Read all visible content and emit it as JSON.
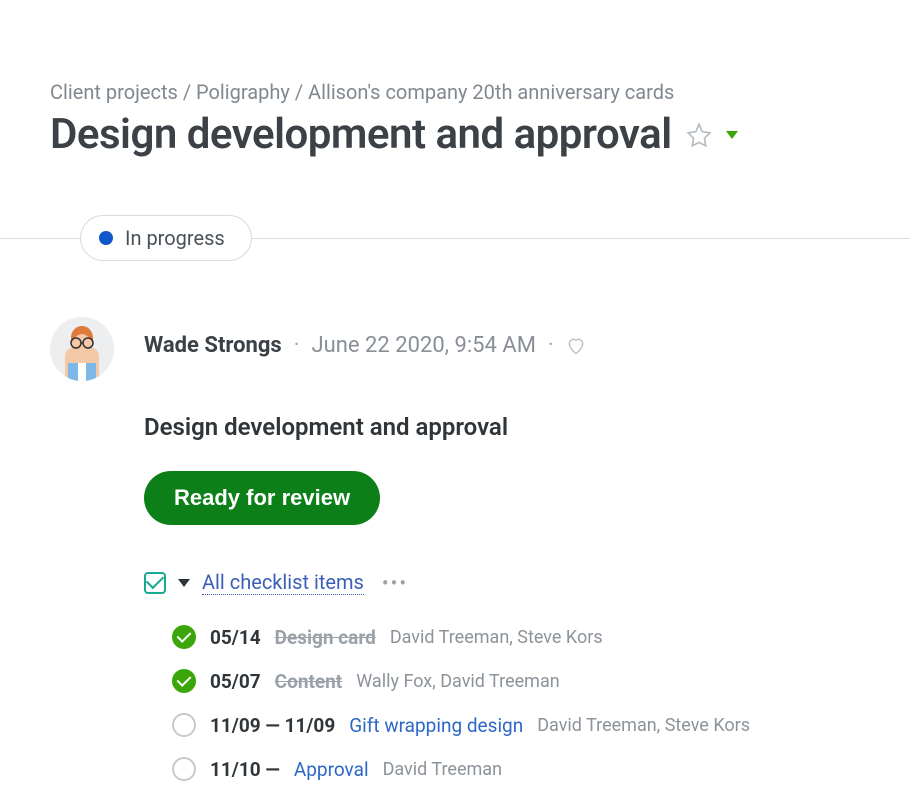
{
  "breadcrumb": {
    "level1": "Client projects",
    "level2": "Poligraphy",
    "level3": "Allison's company 20th anniversary cards"
  },
  "page_title": "Design development and approval",
  "status": {
    "label": "In progress",
    "color": "#1257c9"
  },
  "post": {
    "author": "Wade Strongs",
    "timestamp": "June 22 2020, 9:54 AM",
    "title": "Design development and approval",
    "action_label": "Ready for review"
  },
  "checklist": {
    "header_link": "All checklist items",
    "items": [
      {
        "done": true,
        "date": "05/14",
        "title": "Design card",
        "assignees": "David Treeman, Steve Kors"
      },
      {
        "done": true,
        "date": "05/07",
        "title": "Content",
        "assignees": "Wally Fox, David Treeman"
      },
      {
        "done": false,
        "date": "11/09 — 11/09",
        "title": "Gift wrapping design",
        "assignees": "David Treeman, Steve Kors"
      },
      {
        "done": false,
        "date": "11/10 —",
        "title": "Approval",
        "assignees": "David Treeman"
      }
    ]
  }
}
